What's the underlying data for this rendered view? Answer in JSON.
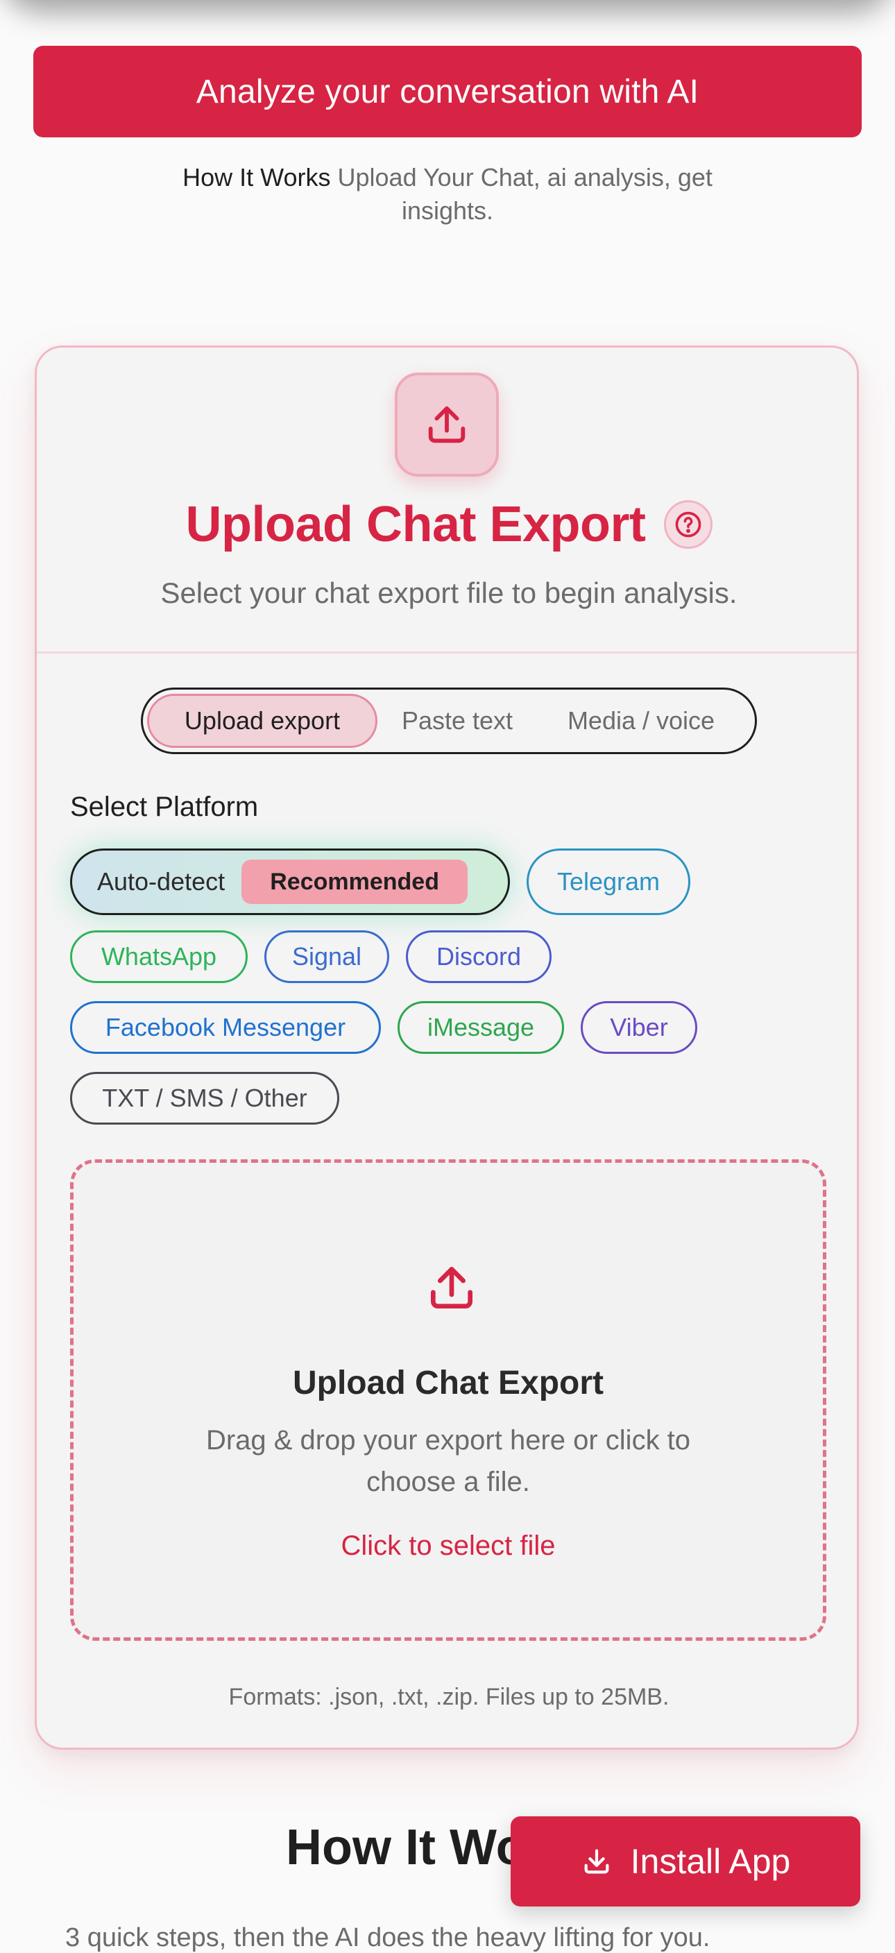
{
  "banner": {
    "label": "Analyze your conversation with AI"
  },
  "how_line": {
    "bold": "How It Works",
    "text": "Upload Your Chat, ai analysis, get insights."
  },
  "card": {
    "title": "Upload Chat Export",
    "subtitle": "Select your chat export file to begin analysis.",
    "icon": "upload-icon",
    "help_icon": "question-circle-icon"
  },
  "mode_tabs": [
    {
      "label": "Upload export",
      "active": true
    },
    {
      "label": "Paste text",
      "active": false
    },
    {
      "label": "Media / voice",
      "active": false
    }
  ],
  "platform": {
    "label": "Select Platform",
    "auto_detect": "Auto-detect",
    "recommended": "Recommended",
    "options": [
      "Telegram",
      "WhatsApp",
      "Signal",
      "Discord",
      "Facebook Messenger",
      "iMessage",
      "Viber",
      "TXT / SMS / Other"
    ],
    "colors": {
      "Telegram": "#2a93c2",
      "WhatsApp": "#2db45a",
      "Signal": "#3b6bd0",
      "Discord": "#4a5cd0",
      "Facebook Messenger": "#1f72d0",
      "iMessage": "#2ea64e",
      "Viber": "#6a4bc4",
      "TXT / SMS / Other": "#4a4a52"
    }
  },
  "dropzone": {
    "title": "Upload Chat Export",
    "description": "Drag & drop your export here or click to choose a file.",
    "link": "Click to select file"
  },
  "formats": "Formats: .json, .txt, .zip. Files up to 25MB.",
  "how_section": {
    "heading": "How It Works",
    "subtitle": "3 quick steps, then the AI does the heavy lifting for you."
  },
  "install": {
    "label": "Install App",
    "icon": "download-icon"
  },
  "colors": {
    "accent": "#d72444",
    "accent_soft": "#f1ccd4"
  }
}
